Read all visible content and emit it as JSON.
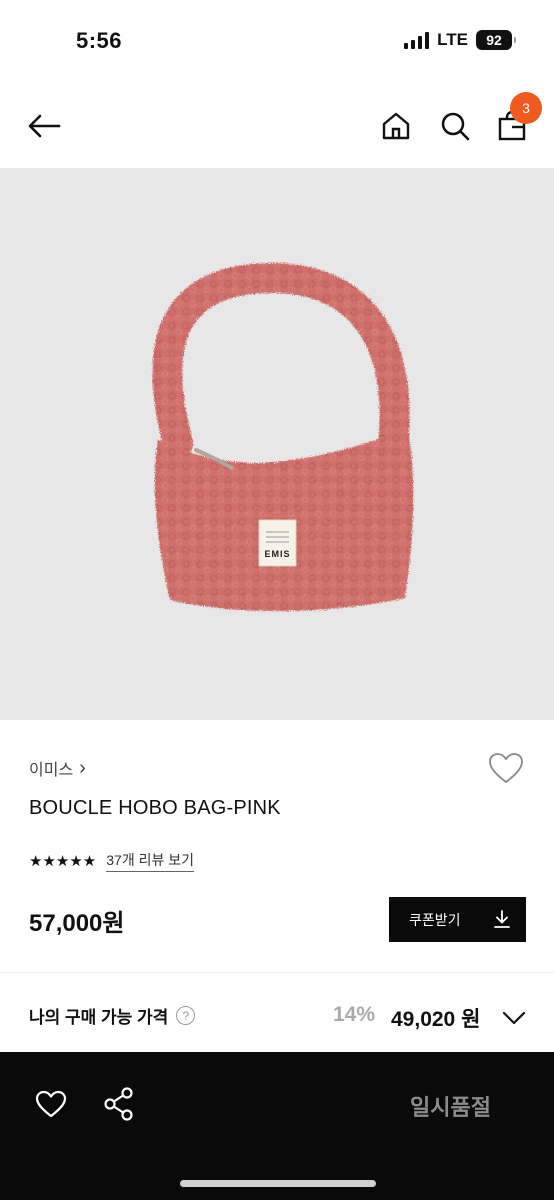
{
  "status_bar": {
    "time": "5:56",
    "network": "LTE",
    "battery": "92"
  },
  "header": {
    "cart_count": "3",
    "icons": [
      "back-arrow-icon",
      "home-icon",
      "search-icon",
      "shopping-bag-icon"
    ]
  },
  "product": {
    "image_label": "EMIS",
    "brand": "이미스",
    "brand_chevron": "›",
    "name": "BOUCLE HOBO BAG-PINK",
    "rating_stars": "★★★★★",
    "review_link": "37개 리뷰 보기",
    "price": "57,000원",
    "coupon_label": "쿠폰받기"
  },
  "my_price": {
    "label": "나의 구매 가능 가격",
    "help": "?",
    "discount": "14%",
    "price": "49,020 원"
  },
  "bottom_bar": {
    "status": "일시품절"
  },
  "colors": {
    "accent_badge": "#f05a1e",
    "bag_pink": "#cf6f6c",
    "bottom_bar": "#0a0a0a"
  }
}
